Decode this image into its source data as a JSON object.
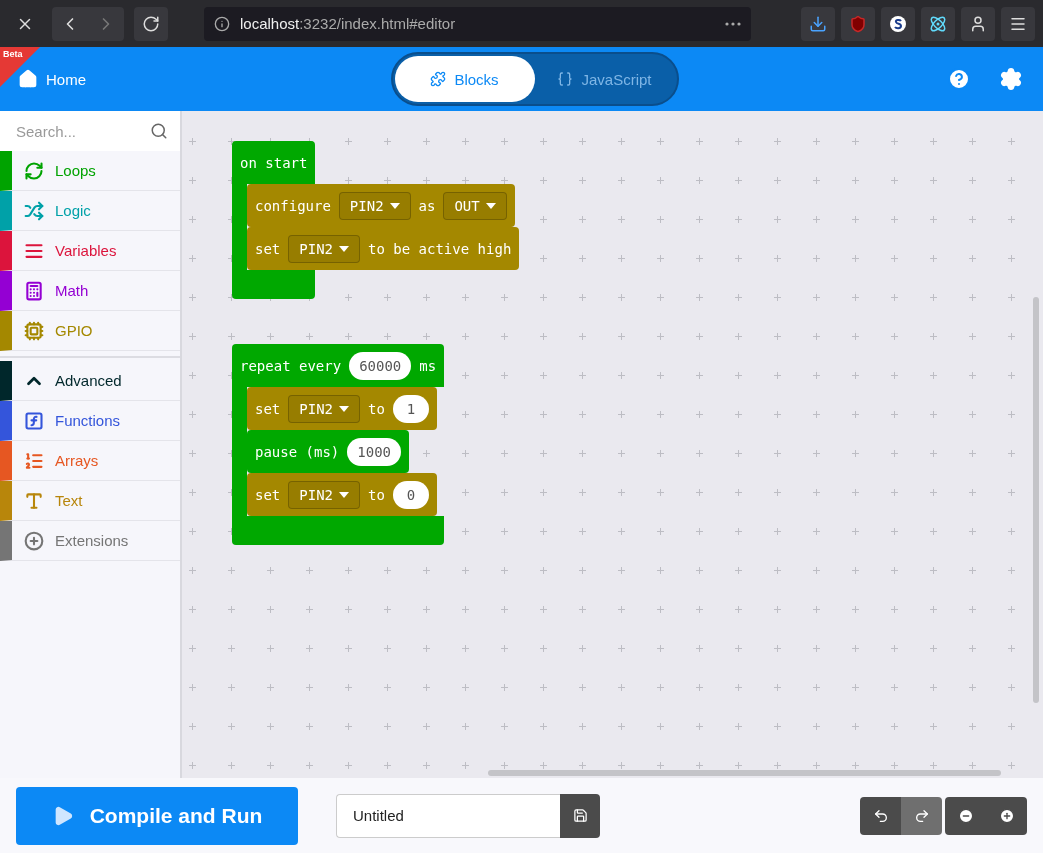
{
  "browser": {
    "url_host": "localhost",
    "url_path": ":3232/index.html#editor"
  },
  "header": {
    "badge": "Beta",
    "home": "Home",
    "tabs": [
      {
        "label": "Blocks",
        "selected": true
      },
      {
        "label": "JavaScript",
        "selected": false
      }
    ]
  },
  "sidebar": {
    "search": {
      "placeholder": "Search..."
    },
    "categories": [
      {
        "label": "Loops",
        "color": "#00a300"
      },
      {
        "label": "Logic",
        "color": "#00a1a8"
      },
      {
        "label": "Variables",
        "color": "#dc143c"
      },
      {
        "label": "Math",
        "color": "#9400d3"
      },
      {
        "label": "GPIO",
        "color": "#a48800"
      }
    ],
    "advanced": {
      "label": "Advanced",
      "color": "#00272b",
      "expanded": true
    },
    "advanced_categories": [
      {
        "label": "Functions",
        "color": "#3455db"
      },
      {
        "label": "Arrays",
        "color": "#e65722"
      },
      {
        "label": "Text",
        "color": "#b8860b"
      },
      {
        "label": "Extensions",
        "color": "#757575"
      }
    ]
  },
  "workspace": {
    "scripts": [
      {
        "kind": "c-block",
        "color": "#00a800",
        "parts": [
          {
            "kind": "label",
            "text": "on start"
          }
        ],
        "children": [
          {
            "kind": "statement",
            "color": "#a48800",
            "parts": [
              {
                "kind": "label",
                "text": "configure"
              },
              {
                "kind": "dropdown",
                "text": "PIN2"
              },
              {
                "kind": "label",
                "text": "as"
              },
              {
                "kind": "dropdown",
                "text": "OUT"
              }
            ]
          },
          {
            "kind": "statement",
            "color": "#a48800",
            "parts": [
              {
                "kind": "label",
                "text": "set"
              },
              {
                "kind": "dropdown",
                "text": "PIN2"
              },
              {
                "kind": "label",
                "text": "to be active high"
              }
            ]
          }
        ]
      },
      {
        "kind": "c-block",
        "color": "#00a800",
        "parts": [
          {
            "kind": "label",
            "text": "repeat every"
          },
          {
            "kind": "number",
            "text": "60000"
          },
          {
            "kind": "label",
            "text": "ms"
          }
        ],
        "children": [
          {
            "kind": "statement",
            "color": "#a48800",
            "parts": [
              {
                "kind": "label",
                "text": "set"
              },
              {
                "kind": "dropdown",
                "text": "PIN2"
              },
              {
                "kind": "label",
                "text": "to"
              },
              {
                "kind": "number",
                "text": "1"
              }
            ]
          },
          {
            "kind": "statement",
            "color": "#00a800",
            "parts": [
              {
                "kind": "label",
                "text": "pause (ms)"
              },
              {
                "kind": "number",
                "text": "1000"
              }
            ]
          },
          {
            "kind": "statement",
            "color": "#a48800",
            "parts": [
              {
                "kind": "label",
                "text": "set"
              },
              {
                "kind": "dropdown",
                "text": "PIN2"
              },
              {
                "kind": "label",
                "text": "to"
              },
              {
                "kind": "number",
                "text": "0"
              }
            ]
          }
        ]
      }
    ]
  },
  "toolbar": {
    "run_button": "Compile and Run",
    "project_name": {
      "value": "Untitled"
    },
    "history": [
      {
        "kind": "undo",
        "disabled": false
      },
      {
        "kind": "redo",
        "disabled": true
      }
    ]
  }
}
